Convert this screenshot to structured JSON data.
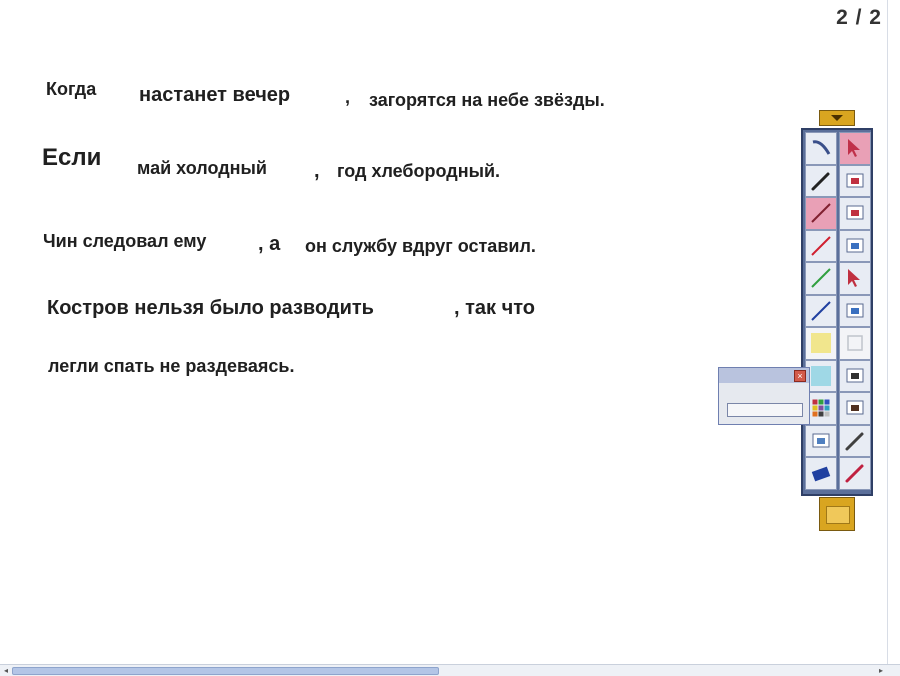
{
  "slide": {
    "counter": "2 / 2"
  },
  "sentences": [
    {
      "parts": [
        "Когда",
        "настанет вечер",
        ",",
        "загорятся на небе звёзды."
      ]
    },
    {
      "parts": [
        "Если",
        "май холодный",
        ",",
        "год хлебородный."
      ]
    },
    {
      "parts": [
        "Чин следовал ему",
        ", а",
        "он службу вдруг оставил."
      ]
    },
    {
      "parts": [
        "Костров нельзя было разводить",
        ", так что",
        "легли спать не раздеваясь."
      ]
    }
  ],
  "toolbar": {
    "buttons": [
      {
        "icon": "wand-icon",
        "color": "#3a4f8a"
      },
      {
        "icon": "select-arrow-icon",
        "color": "#c0304a",
        "active": true
      },
      {
        "icon": "pen-icon",
        "color": "#222222"
      },
      {
        "icon": "shape-icon",
        "color": "#c03040"
      },
      {
        "icon": "line-dark-icon",
        "color": "#802030",
        "active": true
      },
      {
        "icon": "fill-icon",
        "color": "#c03040"
      },
      {
        "icon": "line-red-icon",
        "color": "#d02030"
      },
      {
        "icon": "fill-bucket-icon",
        "color": "#3a70c0"
      },
      {
        "icon": "line-green-icon",
        "color": "#30a040"
      },
      {
        "icon": "pointer-icon",
        "color": "#c03040"
      },
      {
        "icon": "line-blue-icon",
        "color": "#2040a0"
      },
      {
        "icon": "screen-icon",
        "color": "#3a70c0"
      },
      {
        "icon": "highlighter-yellow-icon",
        "color": "#f0e060",
        "dim": true
      },
      {
        "icon": "disabled-tool-icon",
        "color": "#c0c4cc",
        "dim": true
      },
      {
        "icon": "highlighter-cyan-icon",
        "color": "#80d0e0"
      },
      {
        "icon": "stamp-icon",
        "color": "#303030"
      },
      {
        "icon": "palette-icon",
        "color": "#8050a0"
      },
      {
        "icon": "figure-icon",
        "color": "#503020"
      },
      {
        "icon": "gradient-icon",
        "color": "#5080c0"
      },
      {
        "icon": "feather-icon",
        "color": "#404040"
      },
      {
        "icon": "eraser-icon",
        "color": "#2040a0"
      },
      {
        "icon": "magic-pen-icon",
        "color": "#c02040"
      }
    ]
  },
  "colors": {
    "toolbar_bg": "#5b6f9a",
    "handle": "#d9a520",
    "text": "#202020"
  }
}
